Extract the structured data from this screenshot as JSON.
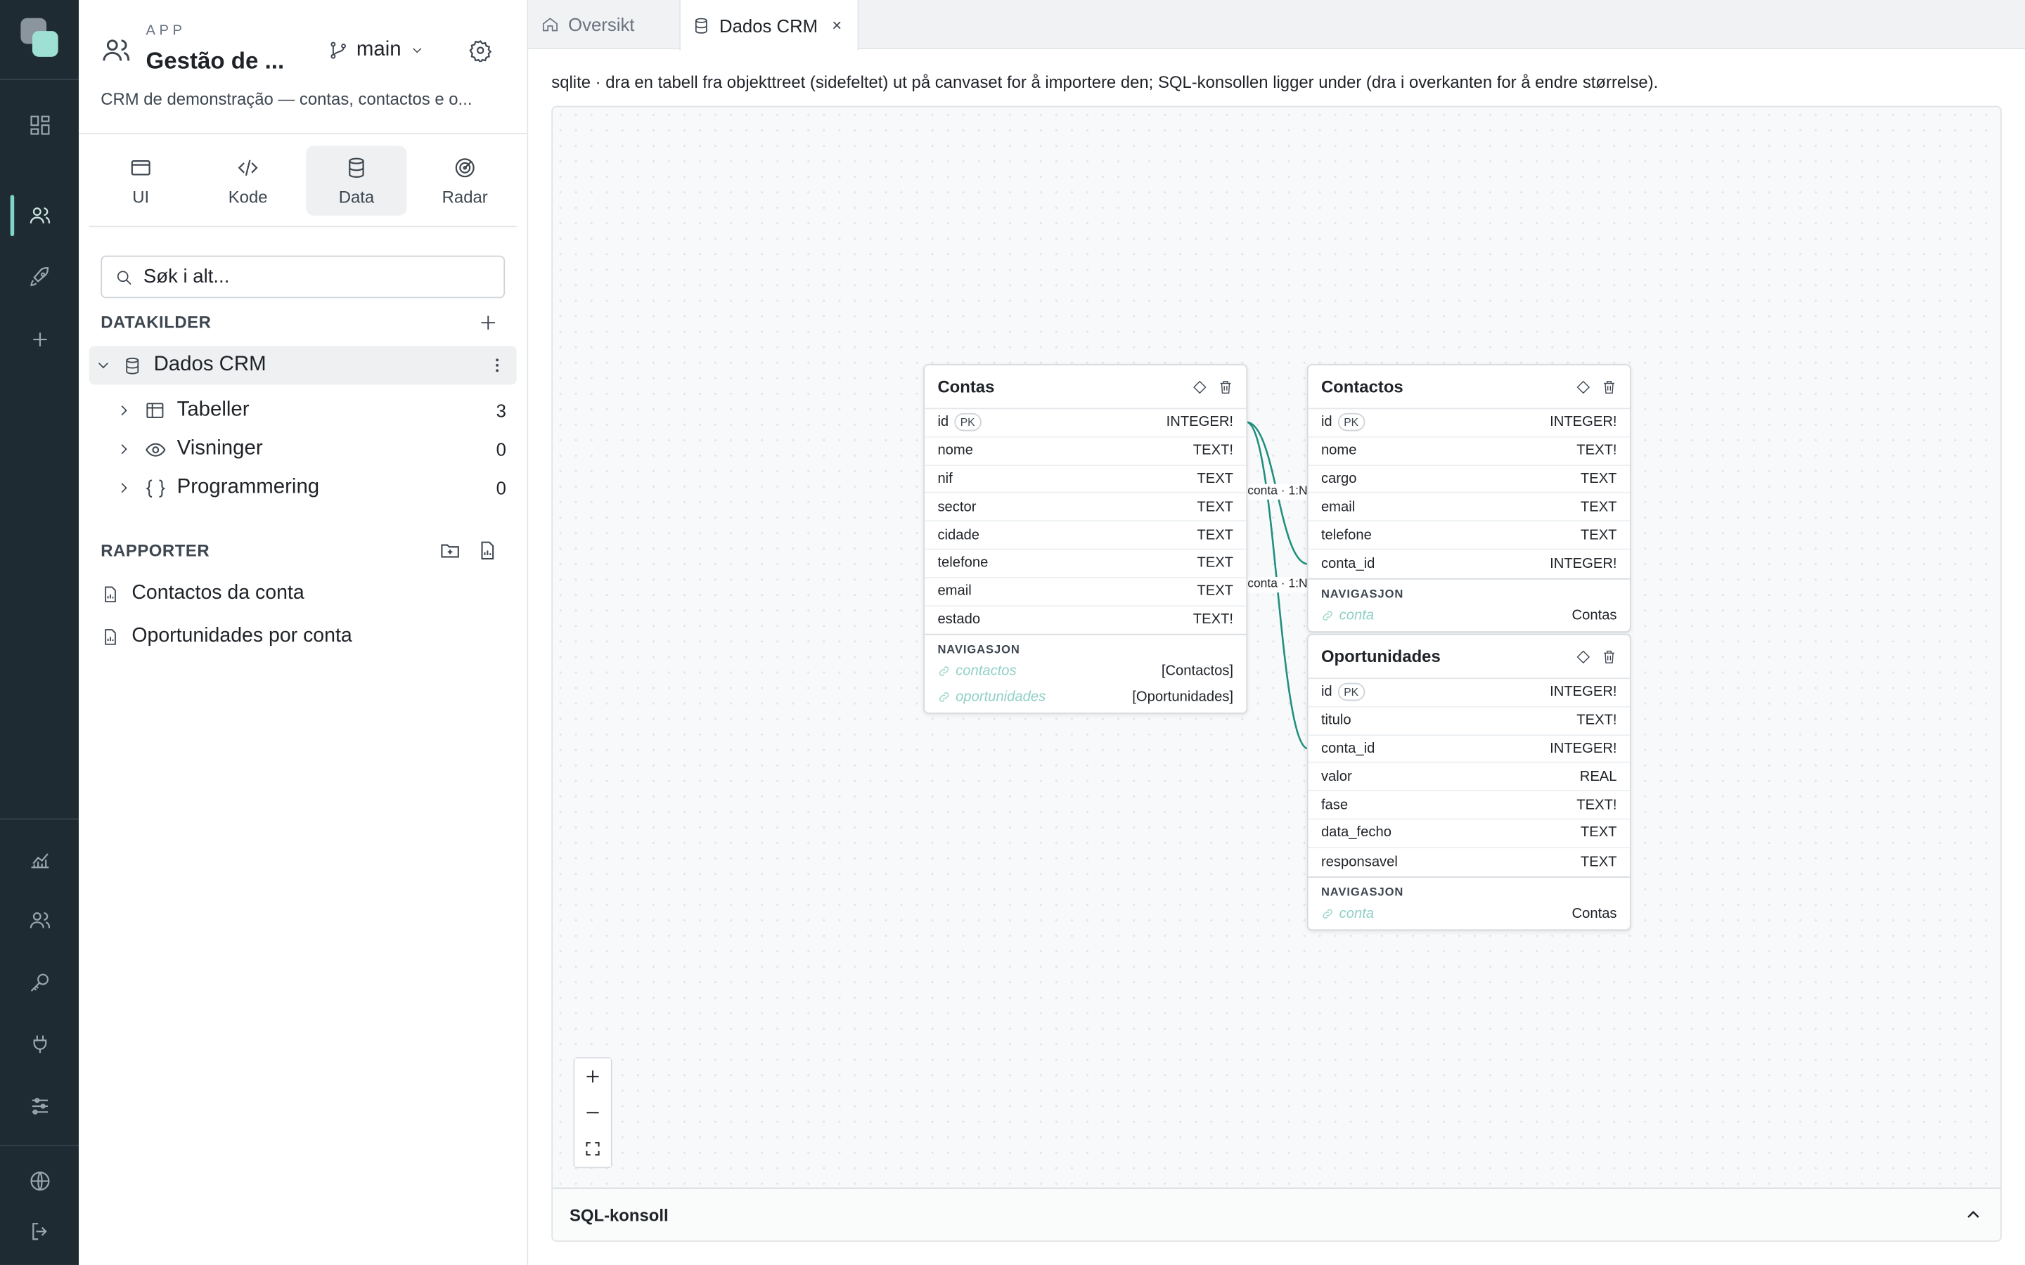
{
  "app": {
    "eyebrow": "APP",
    "title": "Gestão de ...",
    "branch": "main",
    "description": "CRM de demonstração — contas, contactos e o..."
  },
  "sidebar_tabs": [
    {
      "label": "UI",
      "icon": "browser-window-icon"
    },
    {
      "label": "Kode",
      "icon": "code-icon"
    },
    {
      "label": "Data",
      "icon": "database-icon",
      "active": true
    },
    {
      "label": "Radar",
      "icon": "radar-icon"
    }
  ],
  "search": {
    "placeholder": "Søk i alt..."
  },
  "datasources": {
    "heading": "DATAKILDER",
    "source": {
      "name": "Dados CRM"
    },
    "children": [
      {
        "label": "Tabeller",
        "count": "3"
      },
      {
        "label": "Visninger",
        "count": "0"
      },
      {
        "label": "Programmering",
        "count": "0"
      }
    ]
  },
  "reports": {
    "heading": "RAPPORTER",
    "items": [
      "Contactos da conta",
      "Oportunidades por conta"
    ]
  },
  "tabs": [
    {
      "label": "Oversikt",
      "icon": "home-icon"
    },
    {
      "label": "Dados CRM",
      "icon": "database-icon",
      "close": "×",
      "active": true
    }
  ],
  "hint": "sqlite · dra en tabell fra objekttreet (sidefeltet) ut på canvaset for å importere den; SQL-konsollen ligger under (dra i overkanten for å endre størrelse).",
  "tables": {
    "contas": {
      "name": "Contas",
      "columns": [
        {
          "name": "id",
          "pk": "PK",
          "type": "INTEGER!"
        },
        {
          "name": "nome",
          "type": "TEXT!"
        },
        {
          "name": "nif",
          "type": "TEXT"
        },
        {
          "name": "sector",
          "type": "TEXT"
        },
        {
          "name": "cidade",
          "type": "TEXT"
        },
        {
          "name": "telefone",
          "type": "TEXT"
        },
        {
          "name": "email",
          "type": "TEXT"
        },
        {
          "name": "estado",
          "type": "TEXT!"
        }
      ],
      "nav_heading": "NAVIGASJON",
      "nav": [
        {
          "name": "contactos",
          "target": "[Contactos]"
        },
        {
          "name": "oportunidades",
          "target": "[Oportunidades]"
        }
      ]
    },
    "contactos": {
      "name": "Contactos",
      "columns": [
        {
          "name": "id",
          "pk": "PK",
          "type": "INTEGER!"
        },
        {
          "name": "nome",
          "type": "TEXT!"
        },
        {
          "name": "cargo",
          "type": "TEXT"
        },
        {
          "name": "email",
          "type": "TEXT"
        },
        {
          "name": "telefone",
          "type": "TEXT"
        },
        {
          "name": "conta_id",
          "type": "INTEGER!"
        }
      ],
      "nav_heading": "NAVIGASJON",
      "nav": [
        {
          "name": "conta",
          "target": "Contas"
        }
      ]
    },
    "oportunidades": {
      "name": "Oportunidades",
      "columns": [
        {
          "name": "id",
          "pk": "PK",
          "type": "INTEGER!"
        },
        {
          "name": "titulo",
          "type": "TEXT!"
        },
        {
          "name": "conta_id",
          "type": "INTEGER!"
        },
        {
          "name": "valor",
          "type": "REAL"
        },
        {
          "name": "fase",
          "type": "TEXT!"
        },
        {
          "name": "data_fecho",
          "type": "TEXT"
        },
        {
          "name": "responsavel",
          "type": "TEXT"
        }
      ],
      "nav_heading": "NAVIGASJON",
      "nav": [
        {
          "name": "conta",
          "target": "Contas"
        }
      ]
    }
  },
  "relations": [
    {
      "label": "conta · 1:N",
      "from": "Contas.id",
      "to": "Contactos.conta_id"
    },
    {
      "label": "conta · 1:N",
      "from": "Contas.id",
      "to": "Oportunidades.conta_id"
    }
  ],
  "zoom_controls": [
    "+",
    "—",
    "fit"
  ],
  "sql_console": {
    "label": "SQL-konsoll"
  },
  "colors": {
    "rail": "#1f2b33",
    "accent": "#7fd4c8",
    "relation": "#1f8f7e"
  }
}
